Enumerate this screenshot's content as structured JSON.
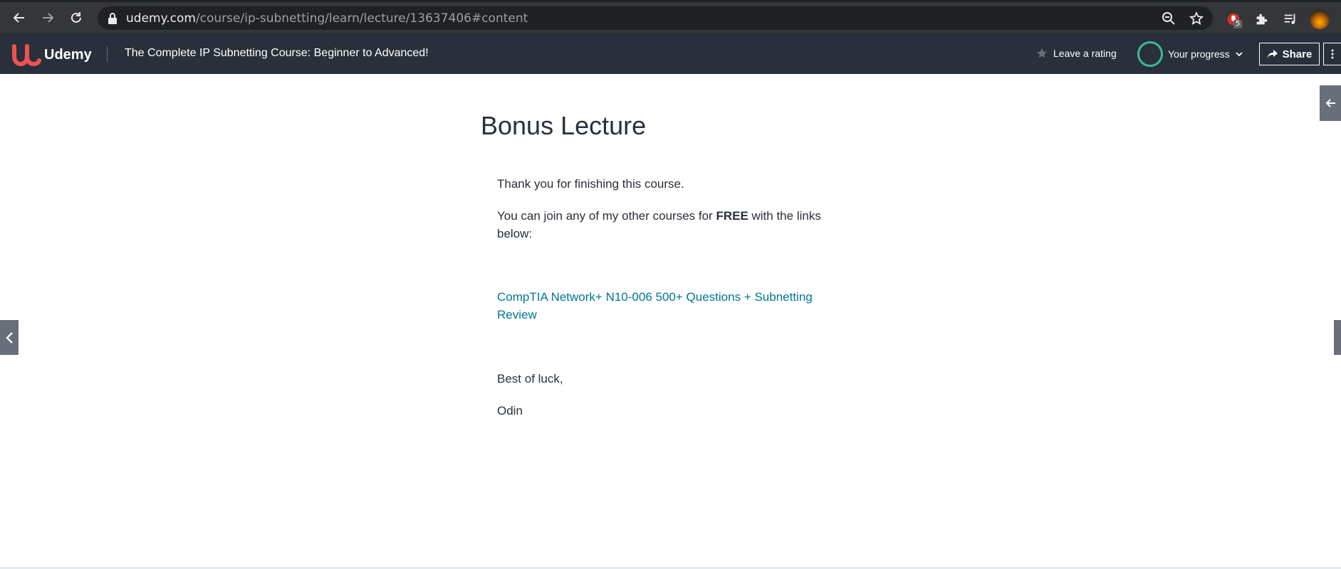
{
  "browser": {
    "url_host": "udemy.com",
    "url_path": "/course/ip-subnetting/learn/lecture/13637406#content",
    "extension_badge": "5"
  },
  "header": {
    "brand": "Udemy",
    "course_title": "The Complete IP Subnetting Course: Beginner to Advanced!",
    "rating_label": "Leave a rating",
    "progress_label": "Your progress",
    "share_label": "Share"
  },
  "lecture": {
    "title": "Bonus Lecture",
    "paragraph1": "Thank you for finishing this course.",
    "paragraph2_before": "You can join any of my other courses for ",
    "paragraph2_bold": "FREE",
    "paragraph2_after": " with the links below:",
    "link_text": "CompTIA Network+ N10-006 500+ Questions + Subnetting Review",
    "closing": "Best of luck,",
    "signature": "Odin"
  },
  "colors": {
    "header_bg": "#29303b",
    "brand_red": "#ec5252",
    "link": "#007791",
    "progress_ring": "#3db89b"
  },
  "icons": [
    "back-icon",
    "forward-icon",
    "reload-icon",
    "lock-icon",
    "zoom-icon",
    "star-bookmark-icon",
    "extension-icon",
    "puzzle-icon",
    "media-queue-icon",
    "profile-avatar",
    "udemy-logo-icon",
    "star-icon",
    "chevron-down-icon",
    "share-icon",
    "more-vertical-icon",
    "chevron-left-icon",
    "arrow-left-icon"
  ]
}
